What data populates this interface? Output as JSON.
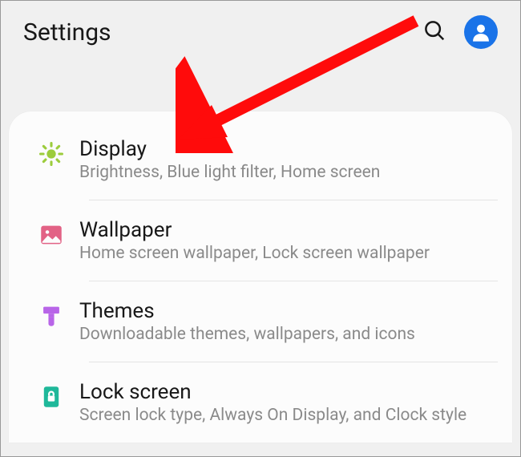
{
  "header": {
    "title": "Settings"
  },
  "items": [
    {
      "id": "display",
      "title": "Display",
      "subtitle": "Brightness, Blue light filter, Home screen",
      "iconColor": "#9ccc3c"
    },
    {
      "id": "wallpaper",
      "title": "Wallpaper",
      "subtitle": "Home screen wallpaper, Lock screen wallpaper",
      "iconColor": "#e26285"
    },
    {
      "id": "themes",
      "title": "Themes",
      "subtitle": "Downloadable themes, wallpapers, and icons",
      "iconColor": "#b865e8"
    },
    {
      "id": "lockscreen",
      "title": "Lock screen",
      "subtitle": "Screen lock type, Always On Display, and Clock style",
      "iconColor": "#1fb89a"
    }
  ],
  "annotation": {
    "target": "display",
    "color": "#ff0b0b"
  }
}
